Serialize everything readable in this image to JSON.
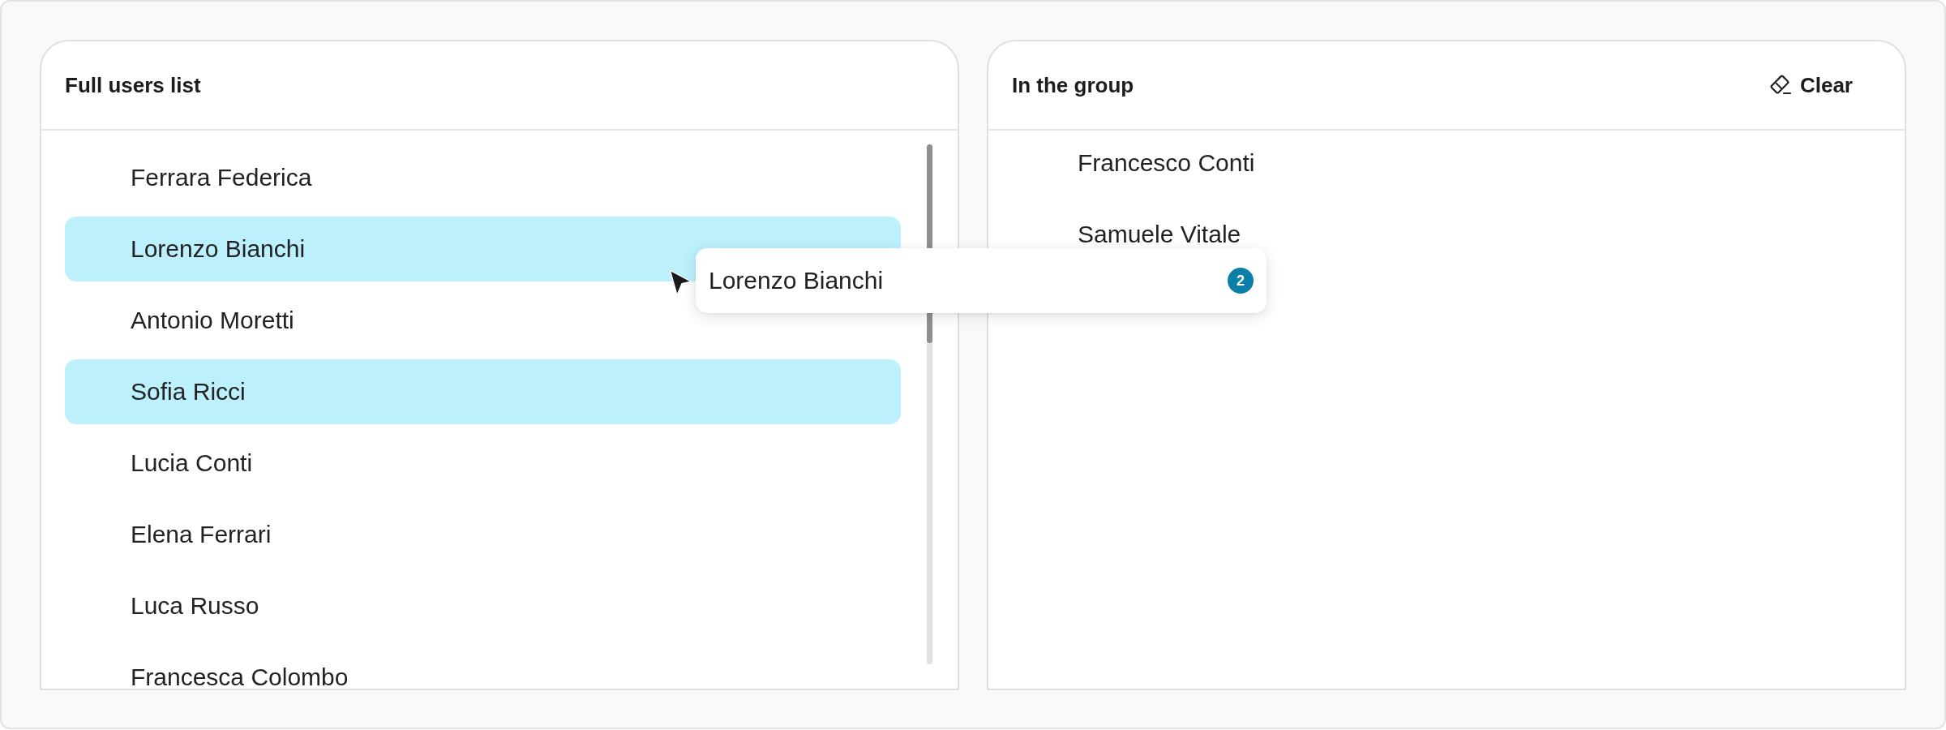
{
  "full_users_list": {
    "title": "Full users list",
    "users": [
      {
        "name": "Ferrara Federica",
        "selected": false
      },
      {
        "name": "Lorenzo Bianchi",
        "selected": true
      },
      {
        "name": "Antonio Moretti",
        "selected": false
      },
      {
        "name": "Sofia Ricci",
        "selected": true
      },
      {
        "name": "Lucia Conti",
        "selected": false
      },
      {
        "name": "Elena Ferrari",
        "selected": false
      },
      {
        "name": "Luca Russo",
        "selected": false
      },
      {
        "name": "Francesca Colombo",
        "selected": false
      }
    ]
  },
  "group": {
    "title": "In the group",
    "clear_button": "Clear",
    "members": [
      {
        "name": "Francesco Conti",
        "selected": false
      },
      {
        "name": "Samuele Vitale",
        "selected": false
      }
    ]
  },
  "drag_preview": {
    "label": "Lorenzo Bianchi",
    "count": "2"
  }
}
